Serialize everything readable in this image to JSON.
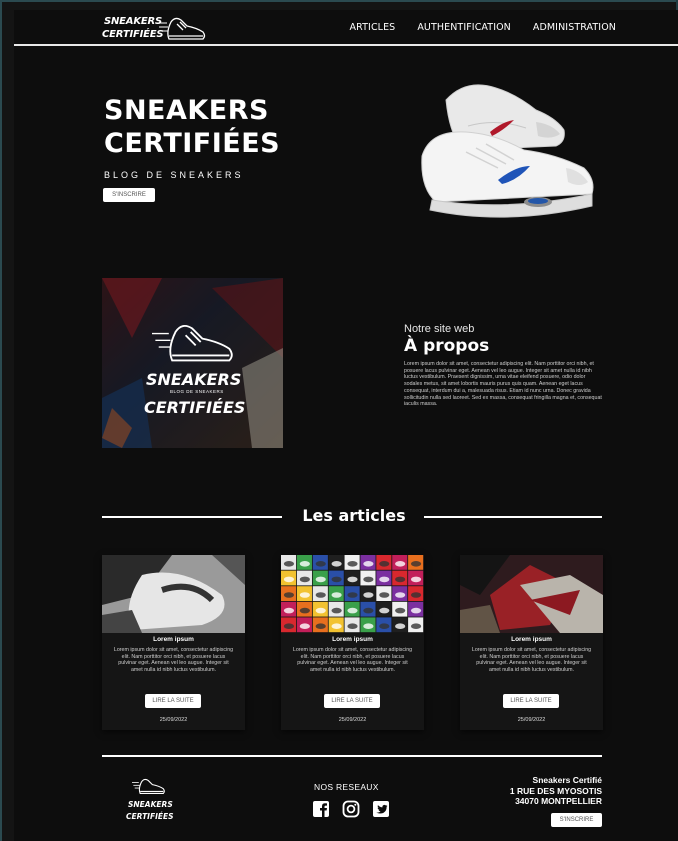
{
  "nav": {
    "logo_line1": "SNEAKERS",
    "logo_line2": "CERTIFIÉES",
    "links": [
      "ARTICLES",
      "AUTHENTIFICATION",
      "ADMINISTRATION"
    ]
  },
  "hero": {
    "title_line1": "SNEAKERS",
    "title_line2": "CERTIFIÉES",
    "subtitle": "BLOG DE SNEAKERS",
    "button": "S'INSCRIRE"
  },
  "about": {
    "logo_line1": "SNEAKERS",
    "logo_tag": "BLOG DE SNEAKERS",
    "logo_line2": "CERTIFIÉES",
    "kicker": "Notre site web",
    "title": "À propos",
    "text": "Lorem ipsum dolor sit amet, consectetur adipiscing elit. Nam porttitor orci nibh, et posuere lacus pulvinar eget. Aenean vel leo augue. Integer sit amet nulla id nibh luctus vestibulum. Praesent dignissim, urna vitae eleifend posuere, odio dolor sodales metus, sit amet lobortis mauris purus quis quam. Aenean eget lacus consequat, interdum dui a, malesuada risus. Etiam id nunc urna. Donec gravida sollicitudin nulla sed laoreet. Sed ex massa, consequat fringilla magna et, consequat iaculis massa."
  },
  "articles": {
    "heading": "Les articles",
    "cards": [
      {
        "title": "Lorem ipsum",
        "text": "Lorem ipsum dolor sit amet, consectetur adipiscing elit. Nam porttitor orci nibh, et posuere lacus pulvinar eget. Aenean vel leo augue. Integer sit amet nulla id nibh luctus vestibulum.",
        "button": "LIRE LA SUITE",
        "date": "25/09/2022"
      },
      {
        "title": "Lorem ipsum",
        "text": "Lorem ipsum dolor sit amet, consectetur adipiscing elit. Nam porttitor orci nibh, et posuere lacus pulvinar eget. Aenean vel leo augue. Integer sit amet nulla id nibh luctus vestibulum.",
        "button": "LIRE LA SUITE",
        "date": "25/09/2022"
      },
      {
        "title": "Lorem ipsum",
        "text": "Lorem ipsum dolor sit amet, consectetur adipiscing elit. Nam porttitor orci nibh, et posuere lacus pulvinar eget. Aenean vel leo augue. Integer sit amet nulla id nibh luctus vestibulum.",
        "button": "LIRE LA SUITE",
        "date": "25/09/2022"
      }
    ]
  },
  "footer": {
    "logo_line1": "SNEAKERS",
    "logo_line2": "CERTIFIÉES",
    "social_title": "NOS RESEAUX",
    "social_icons": [
      "facebook-icon",
      "instagram-icon",
      "twitter-icon"
    ],
    "address_line1": "Sneakers Certifié",
    "address_line2": "1 RUE DES MYOSOTIS",
    "address_line3": "34070 MONTPELLIER",
    "button": "S'INSCRIRE"
  }
}
